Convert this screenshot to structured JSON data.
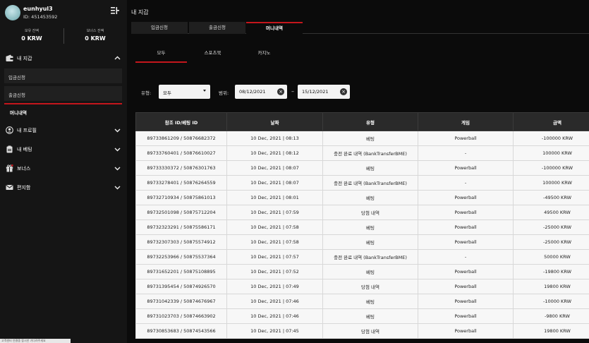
{
  "user": {
    "name": "eunhyul3",
    "id_text": "ID: 451453592"
  },
  "balances": [
    {
      "label": "보유 잔액",
      "value": "0 KRW"
    },
    {
      "label": "보너스 잔액",
      "value": "0 KRW"
    }
  ],
  "sidebar": {
    "wallet": {
      "label": "내 지갑",
      "subitems": [
        "입금신청",
        "출금신청",
        "머니내역"
      ]
    },
    "sections": [
      {
        "label": "내 프로필",
        "icon": "user-circle-icon"
      },
      {
        "label": "내 베팅",
        "icon": "clipboard-icon"
      },
      {
        "label": "보너스",
        "icon": "gift-icon"
      },
      {
        "label": "편지함",
        "icon": "mail-icon"
      }
    ]
  },
  "page": {
    "title": "내 지갑"
  },
  "tabs": [
    "입금신청",
    "출금신청",
    "머니내역"
  ],
  "subtabs": [
    "모두",
    "스포츠북",
    "카지노"
  ],
  "filters": {
    "type_label": "유형:",
    "type_value": "모두",
    "range_label": "범위:",
    "date_from": "08/12/2021",
    "date_to": "15/12/2021",
    "dash": "–",
    "clear_glyph": "×"
  },
  "table": {
    "headers": [
      "참조 ID/베팅 ID",
      "날짜",
      "유형",
      "게임",
      "금액"
    ],
    "rows": [
      [
        "89733861209 / 50876682372",
        "10 Dec, 2021 | 08:13",
        "베팅",
        "Powerball",
        "-100000 KRW"
      ],
      [
        "89733760401 / 50876610027",
        "10 Dec, 2021 | 08:12",
        "충전 완료 내역 (BankTransferBME)",
        "-",
        "100000 KRW"
      ],
      [
        "89733330372 / 50876301763",
        "10 Dec, 2021 | 08:07",
        "베팅",
        "Powerball",
        "-100000 KRW"
      ],
      [
        "89733278401 / 50876264559",
        "10 Dec, 2021 | 08:07",
        "충전 완료 내역 (BankTransferBME)",
        "-",
        "100000 KRW"
      ],
      [
        "89732710934 / 50875861013",
        "10 Dec, 2021 | 08:01",
        "베팅",
        "Powerball",
        "-49500 KRW"
      ],
      [
        "89732501098 / 50875712204",
        "10 Dec, 2021 | 07:59",
        "당첨 내역",
        "Powerball",
        "49500 KRW"
      ],
      [
        "89732323291 / 50875586171",
        "10 Dec, 2021 | 07:58",
        "베팅",
        "Powerball",
        "-25000 KRW"
      ],
      [
        "89732307303 / 50875574912",
        "10 Dec, 2021 | 07:58",
        "베팅",
        "Powerball",
        "-25000 KRW"
      ],
      [
        "89732253966 / 50875537364",
        "10 Dec, 2021 | 07:57",
        "충전 완료 내역 (BankTransferBME)",
        "-",
        "50000 KRW"
      ],
      [
        "89731652201 / 50875108895",
        "10 Dec, 2021 | 07:52",
        "베팅",
        "Powerball",
        "-19800 KRW"
      ],
      [
        "89731395454 / 50874926570",
        "10 Dec, 2021 | 07:49",
        "당첨 내역",
        "Powerball",
        "19800 KRW"
      ],
      [
        "89731042339 / 50874676967",
        "10 Dec, 2021 | 07:46",
        "베팅",
        "Powerball",
        "-10000 KRW"
      ],
      [
        "89731023703 / 50874663902",
        "10 Dec, 2021 | 07:46",
        "베팅",
        "Powerball",
        "-9800 KRW"
      ],
      [
        "89730853683 / 50874543566",
        "10 Dec, 2021 | 07:45",
        "당첨 내역",
        "Powerball",
        "19800 KRW"
      ]
    ]
  },
  "status_bar": "고객센터 연결중 잠시만 기다려주세요",
  "colors": {
    "accent": "#c4161c",
    "sidebar_bg": "#151515",
    "main_bg": "#0b0b0b"
  }
}
